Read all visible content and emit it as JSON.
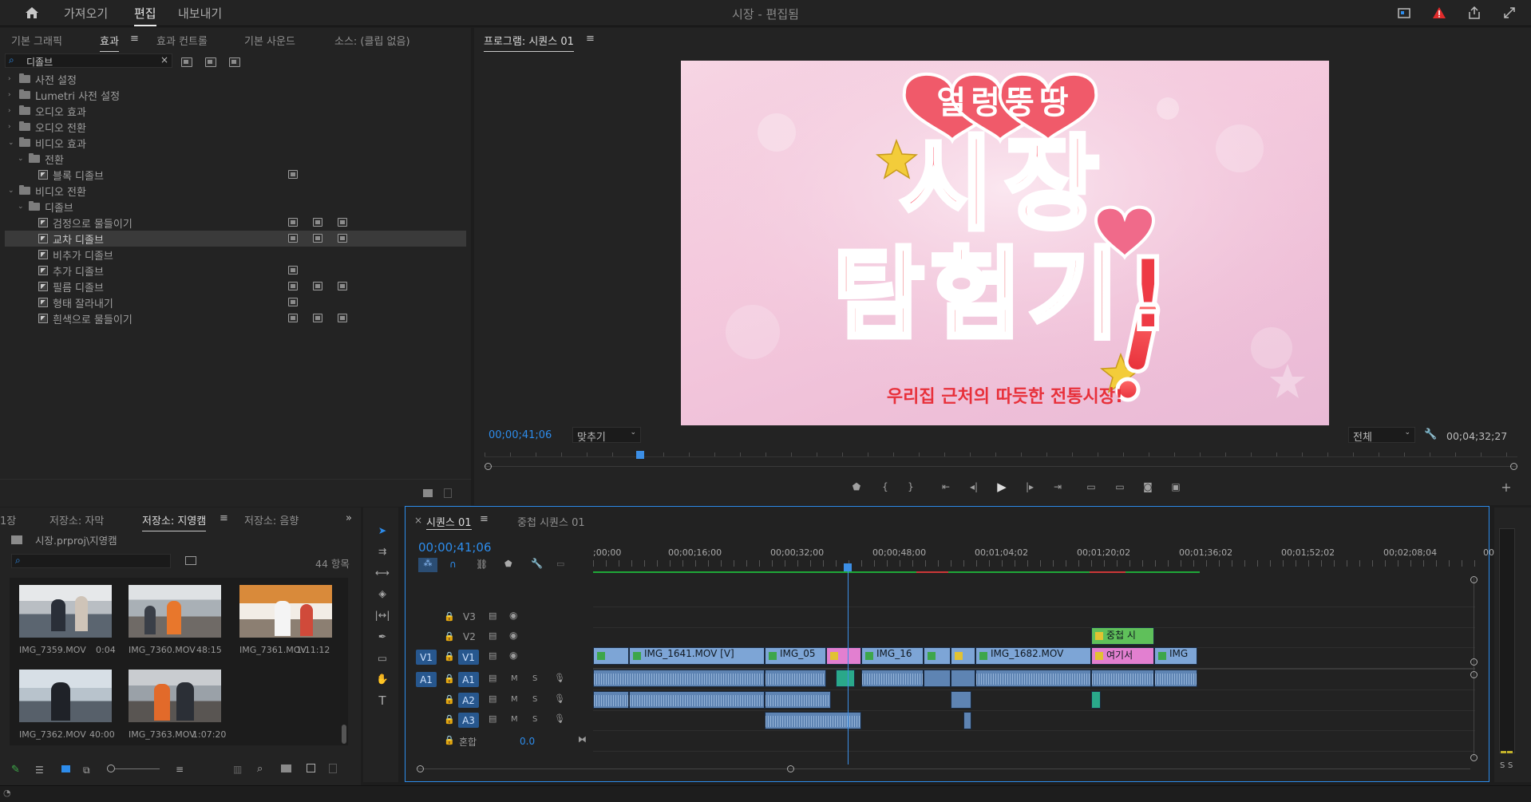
{
  "header": {
    "nav": [
      "가져오기",
      "편집",
      "내보내기"
    ],
    "active_nav": "편집",
    "title": "시장 - 편집됨"
  },
  "effects_panel": {
    "tabs": [
      "기본 그래픽",
      "효과",
      "효과 컨트롤",
      "기본 사운드",
      "소스: (클립 없음)"
    ],
    "search_value": "디졸브",
    "tree": [
      {
        "label": "사전 설정",
        "level": 0,
        "type": "folder",
        "expanded": false
      },
      {
        "label": "Lumetri 사전 설정",
        "level": 0,
        "type": "folder",
        "expanded": false
      },
      {
        "label": "오디오 효과",
        "level": 0,
        "type": "folder",
        "expanded": false
      },
      {
        "label": "오디오 전환",
        "level": 0,
        "type": "folder",
        "expanded": false
      },
      {
        "label": "비디오 효과",
        "level": 0,
        "type": "folder",
        "expanded": true
      },
      {
        "label": "전환",
        "level": 1,
        "type": "folder",
        "expanded": true
      },
      {
        "label": "블록 디졸브",
        "level": 2,
        "type": "effect",
        "badges": 1
      },
      {
        "label": "비디오 전환",
        "level": 0,
        "type": "folder",
        "expanded": true
      },
      {
        "label": "디졸브",
        "level": 1,
        "type": "folder",
        "expanded": true
      },
      {
        "label": "검정으로 물들이기",
        "level": 2,
        "type": "effect",
        "badges": 3
      },
      {
        "label": "교차 디졸브",
        "level": 2,
        "type": "effect",
        "badges": 3,
        "selected": true
      },
      {
        "label": "비추가 디졸브",
        "level": 2,
        "type": "effect",
        "badges": 0
      },
      {
        "label": "추가 디졸브",
        "level": 2,
        "type": "effect",
        "badges": 1
      },
      {
        "label": "필름 디졸브",
        "level": 2,
        "type": "effect",
        "badges": 3
      },
      {
        "label": "형태 잘라내기",
        "level": 2,
        "type": "effect",
        "badges": 1
      },
      {
        "label": "흰색으로 물들이기",
        "level": 2,
        "type": "effect",
        "badges": 3
      }
    ]
  },
  "program_monitor": {
    "title": "프로그램: 시퀀스 01",
    "timecode": "00;00;41;06",
    "fit": "맞추기",
    "quality": "전체",
    "duration": "00;04;32;27",
    "frame": {
      "badge_text": "얼렁뚱땅",
      "title_line1": "시장",
      "title_line2": "탐험기!",
      "subtitle": "우리집 근처의 따듯한 전통시장!"
    }
  },
  "project_panel": {
    "tabs": [
      "1장",
      "저장소: 자막",
      "저장소: 지영캠",
      "저장소: 음향"
    ],
    "active_tab": "저장소: 지영캠",
    "path": "시장.prproj\\지영캠",
    "item_count": "44 항목",
    "items": [
      {
        "name": "IMG_7359.MOV",
        "duration": "0:04"
      },
      {
        "name": "IMG_7360.MOV",
        "duration": "48:15"
      },
      {
        "name": "IMG_7361.MOV",
        "duration": "1:11:12"
      },
      {
        "name": "IMG_7362.MOV",
        "duration": "40:00"
      },
      {
        "name": "IMG_7363.MOV",
        "duration": "1:07:20"
      }
    ]
  },
  "timeline": {
    "tabs": [
      "시퀀스 01",
      "중첩 시퀀스 01"
    ],
    "timecode": "00;00;41;06",
    "ruler": [
      ";00;00",
      "00;00;16;00",
      "00;00;32;00",
      "00;00;48;00",
      "00;01;04;02",
      "00;01;20;02",
      "00;01;36;02",
      "00;01;52;02",
      "00;02;08;04",
      "00"
    ],
    "tracks": {
      "v3": "V3",
      "v2": "V2",
      "v1_src": "V1",
      "v1": "V1",
      "a1_src": "A1",
      "a1": "A1",
      "a2": "A2",
      "a3": "A3",
      "mix": "혼합",
      "mix_value": "0.0",
      "mute": "M",
      "solo": "S"
    },
    "video_clips": {
      "c1": "IMG_1641.MOV [V]",
      "c2": "IMG_05",
      "c3": "IMG_16",
      "c4": "IMG_1682.MOV",
      "c5": "여기서",
      "c6": "IMG",
      "v2": "중첩 시"
    }
  },
  "audio_meter": {
    "labels": [
      "S",
      "S"
    ]
  },
  "colors": {
    "accent_blue": "#2d8ceb",
    "clip_video": "#7da5d6",
    "clip_audio": "#5e84b3",
    "clip_pink": "#e27fd0",
    "clip_green": "#3da64a",
    "playhead": "#3c8fe6"
  }
}
